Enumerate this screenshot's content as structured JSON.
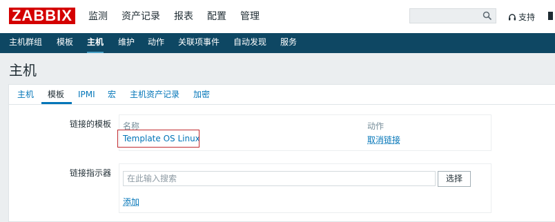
{
  "logo": "ZABBIX",
  "topnav": [
    "监测",
    "资产记录",
    "报表",
    "配置",
    "管理"
  ],
  "support": "支持",
  "subnav": [
    "主机群组",
    "模板",
    "主机",
    "维护",
    "动作",
    "关联项事件",
    "自动发现",
    "服务"
  ],
  "page_title": "主机",
  "tabs": [
    "主机",
    "模板",
    "IPMI",
    "宏",
    "主机资产记录",
    "加密"
  ],
  "linked_templates": {
    "label": "链接的模板",
    "col_name": "名称",
    "col_action": "动作",
    "template_name": "Template OS Linux",
    "unlink": "取消链接"
  },
  "link_indicator": {
    "label": "链接指示器",
    "placeholder": "在此输入搜索",
    "select_button": "选择",
    "add_link": "添加"
  }
}
